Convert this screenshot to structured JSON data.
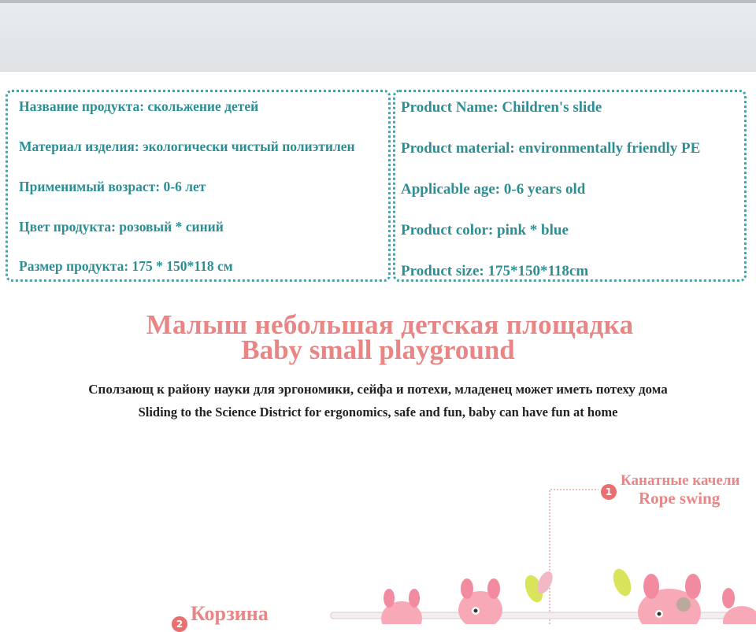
{
  "specs_ru": {
    "name": "Название продукта: скольжение детей",
    "material": "Материал изделия: экологически чистый полиэтилен",
    "age": "Применимый возраст: 0-6 лет",
    "color": "Цвет продукта: розовый * синий",
    "size": "Размер продукта: 175 * 150*118 см"
  },
  "specs_en": {
    "name": "Product Name: Children's slide",
    "material": "Product material: environmentally friendly PE",
    "age": "Applicable age: 0-6 years old",
    "color": "Product color: pink * blue",
    "size": "Product size: 175*150*118cm"
  },
  "headline": {
    "ru": "Малыш небольшая детская площадка",
    "en": "Baby small playground"
  },
  "subtitle": {
    "ru": "Сползающ к району науки для эргономики, сейфа и потехи, младенец может иметь потеху дома",
    "en": "Sliding to the Science District for ergonomics, safe and fun, baby can have fun at home"
  },
  "callouts": {
    "rope": {
      "number": "1",
      "ru": "Канатные качели",
      "en": "Rope swing"
    },
    "basket": {
      "number": "2",
      "ru": "Корзина"
    }
  },
  "colors": {
    "teal": "#2b8f95",
    "pink": "#ea8585",
    "callout_dot": "#ea6f6f"
  }
}
